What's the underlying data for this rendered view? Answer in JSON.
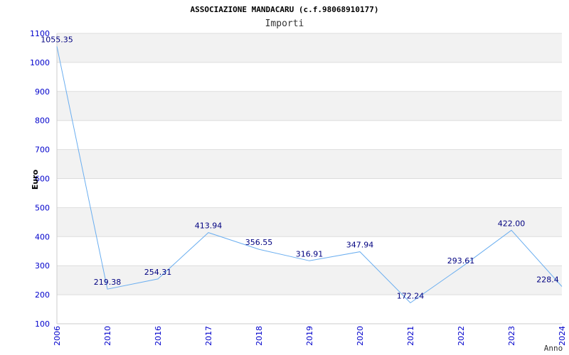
{
  "chart_data": {
    "type": "line",
    "title": "ASSOCIAZIONE MANDACARU (c.f.98068910177)",
    "subtitle": "Importi",
    "xlabel": "Anno",
    "ylabel": "Euro",
    "ylim": [
      100,
      1100
    ],
    "yticks": [
      "100",
      "200",
      "300",
      "400",
      "500",
      "600",
      "700",
      "800",
      "900",
      "1000",
      "1100"
    ],
    "categories": [
      "2006",
      "2010",
      "2016",
      "2017",
      "2018",
      "2019",
      "2020",
      "2021",
      "2022",
      "2023",
      "2024"
    ],
    "series": [
      {
        "values": [
          1055.35,
          219.38,
          254.31,
          413.94,
          356.55,
          316.91,
          347.94,
          172.24,
          293.61,
          422.0,
          228.4
        ],
        "labels": [
          "1055.35",
          "219.38",
          "254.31",
          "413.94",
          "356.55",
          "316.91",
          "347.94",
          "172.24",
          "293.61",
          "422.00",
          "228.4"
        ]
      }
    ],
    "grid": true,
    "colors": {
      "line": "#6aaef0",
      "band": "#f2f2f2",
      "tick": "#0000cc",
      "label": "#000080"
    }
  }
}
